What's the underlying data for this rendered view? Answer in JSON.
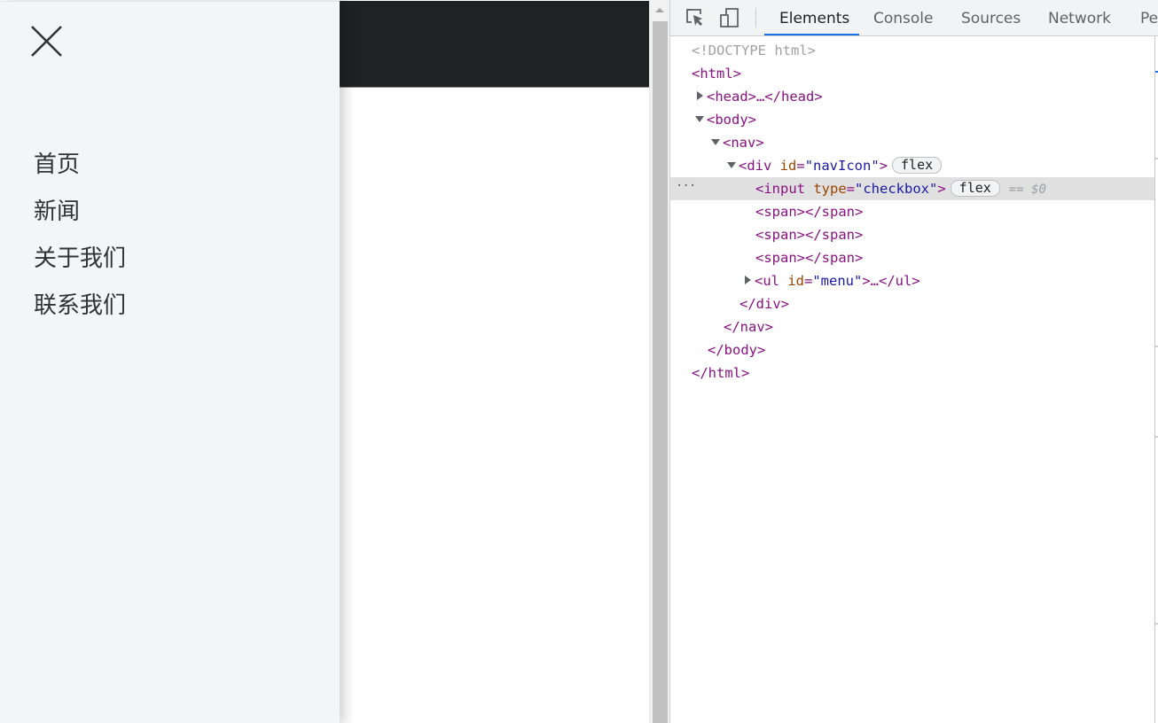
{
  "page": {
    "drawer": {
      "close_icon": "close-x-icon",
      "menu_items": [
        "首页",
        "新闻",
        "关于我们",
        "联系我们"
      ]
    }
  },
  "devtools": {
    "toolbar": {
      "inspect_icon": "inspect-element-icon",
      "device_icon": "device-toolbar-icon",
      "tabs": [
        "Elements",
        "Console",
        "Sources",
        "Network",
        "Per"
      ],
      "active_tab": "Elements"
    },
    "tree": {
      "doctype": "<!DOCTYPE html>",
      "html_open": "<html>",
      "head": "<head>…</head>",
      "body_open": "<body>",
      "nav_open": "<nav>",
      "div_tag": "<div ",
      "div_attr_name": "id",
      "div_attr_value": "\"navIcon\"",
      "div_close_bracket": ">",
      "div_badge": "flex",
      "input_tag": "<input ",
      "input_attr_name": "type",
      "input_attr_value": "\"checkbox\"",
      "input_close_bracket": ">",
      "input_badge": "flex",
      "selected_marker": "== $0",
      "dots": "···",
      "span_1": "<span></span>",
      "span_2": "<span></span>",
      "span_3": "<span></span>",
      "ul_tag": "<ul ",
      "ul_attr_name": "id",
      "ul_attr_value": "\"menu\"",
      "ul_rest": ">…</ul>",
      "div_close": "</div>",
      "nav_close": "</nav>",
      "body_close": "</body>",
      "html_close": "</html>",
      "equals": "="
    }
  },
  "colors": {
    "tag": "#881280",
    "attr_name": "#994500",
    "attr_value": "#1a1aa6",
    "active_tab_underline": "#1a73e8",
    "drawer_bg": "#f4f5f9",
    "topbar_bg": "#202124"
  }
}
